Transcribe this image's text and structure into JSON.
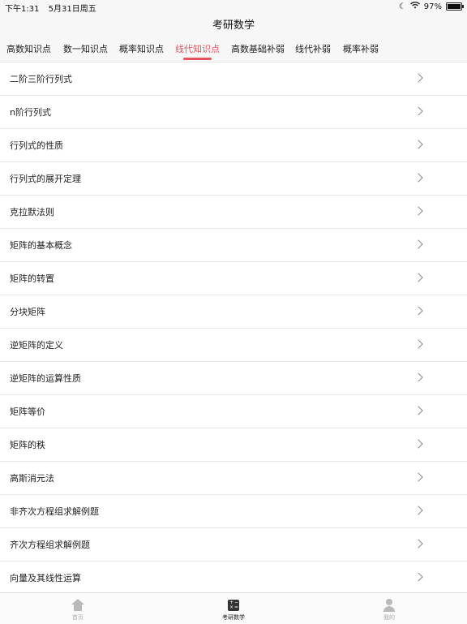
{
  "status": {
    "time": "下午1:31",
    "date": "5月31日周五",
    "battery_text": "97%",
    "battery_level": 0.97
  },
  "nav": {
    "title": "考研数学"
  },
  "tabs": [
    {
      "label": "高数知识点",
      "active": false
    },
    {
      "label": "数一知识点",
      "active": false
    },
    {
      "label": "概率知识点",
      "active": false
    },
    {
      "label": "线代知识点",
      "active": true
    },
    {
      "label": "高数基础补弱",
      "active": false
    },
    {
      "label": "线代补弱",
      "active": false
    },
    {
      "label": "概率补弱",
      "active": false
    }
  ],
  "accent_color": "#e0555e",
  "list": [
    "二阶三阶行列式",
    "n阶行列式",
    "行列式的性质",
    "行列式的展开定理",
    "克拉默法则",
    "矩阵的基本概念",
    "矩阵的转置",
    "分块矩阵",
    "逆矩阵的定义",
    "逆矩阵的运算性质",
    "矩阵等价",
    "矩阵的秩",
    "高斯消元法",
    "非齐次方程组求解例题",
    "齐次方程组求解例题",
    "向量及其线性运算"
  ],
  "bottom_tabs": [
    {
      "label": "首页",
      "icon": "home-icon",
      "active": false
    },
    {
      "label": "考研数学",
      "icon": "calculator-icon",
      "active": true
    },
    {
      "label": "我的",
      "icon": "person-icon",
      "active": false
    }
  ]
}
